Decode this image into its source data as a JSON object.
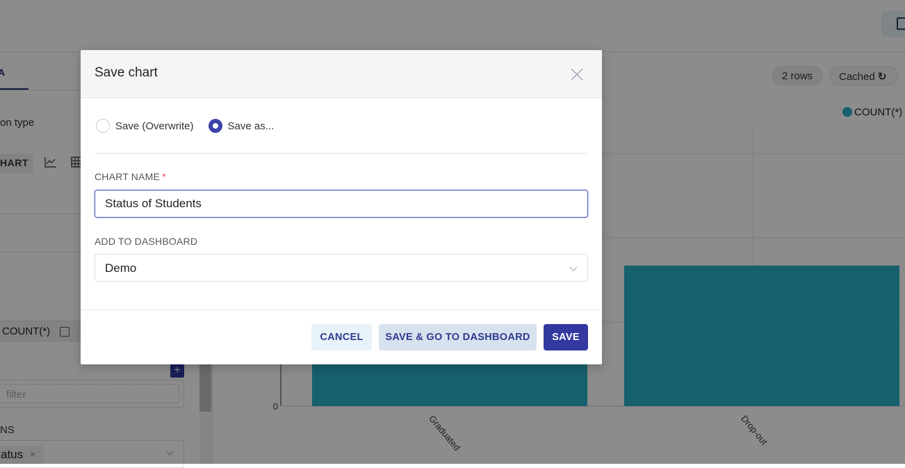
{
  "background": {
    "left_panel": {
      "tab_label_partial": "A",
      "visualization_type_label": "on type",
      "chart_chip_label": "HART",
      "metric_label": "COUNT(*)",
      "filter_placeholder": "filter",
      "dimensions_label": "NS",
      "dimension_chip": "atus",
      "dimension_chip_remove": "×"
    },
    "chart_panel": {
      "rows_pill": "2 rows",
      "cached_pill": "Cached",
      "legend_label": "COUNT(*)"
    }
  },
  "colors": {
    "bar": "#2bb0c6",
    "primary": "#3339a0",
    "required": "#e04355"
  },
  "modal": {
    "title": "Save chart",
    "radio_options": [
      {
        "label": "Save (Overwrite)",
        "checked": false
      },
      {
        "label": "Save as...",
        "checked": true
      }
    ],
    "chart_name_label": "CHART NAME",
    "required_marker": "*",
    "chart_name_value": "Status of Students",
    "dashboard_label": "ADD TO DASHBOARD",
    "dashboard_value": "Demo",
    "buttons": {
      "cancel": "CANCEL",
      "save_and_go": "SAVE & GO TO DASHBOARD",
      "save": "SAVE"
    }
  },
  "chart_data": {
    "type": "bar",
    "categories": [
      "Graduated",
      "Drop-out"
    ],
    "series": [
      {
        "name": "COUNT(*)",
        "values": [
          null,
          1.67
        ]
      }
    ],
    "value_note": "Graduated bar top hidden by modal; Drop-out value relative to gridline units",
    "ytick_labels_visible": [
      "0"
    ],
    "ylim": [
      0,
      3
    ],
    "grid": true,
    "legend": "top-right",
    "title": "",
    "xlabel": "",
    "ylabel": ""
  }
}
